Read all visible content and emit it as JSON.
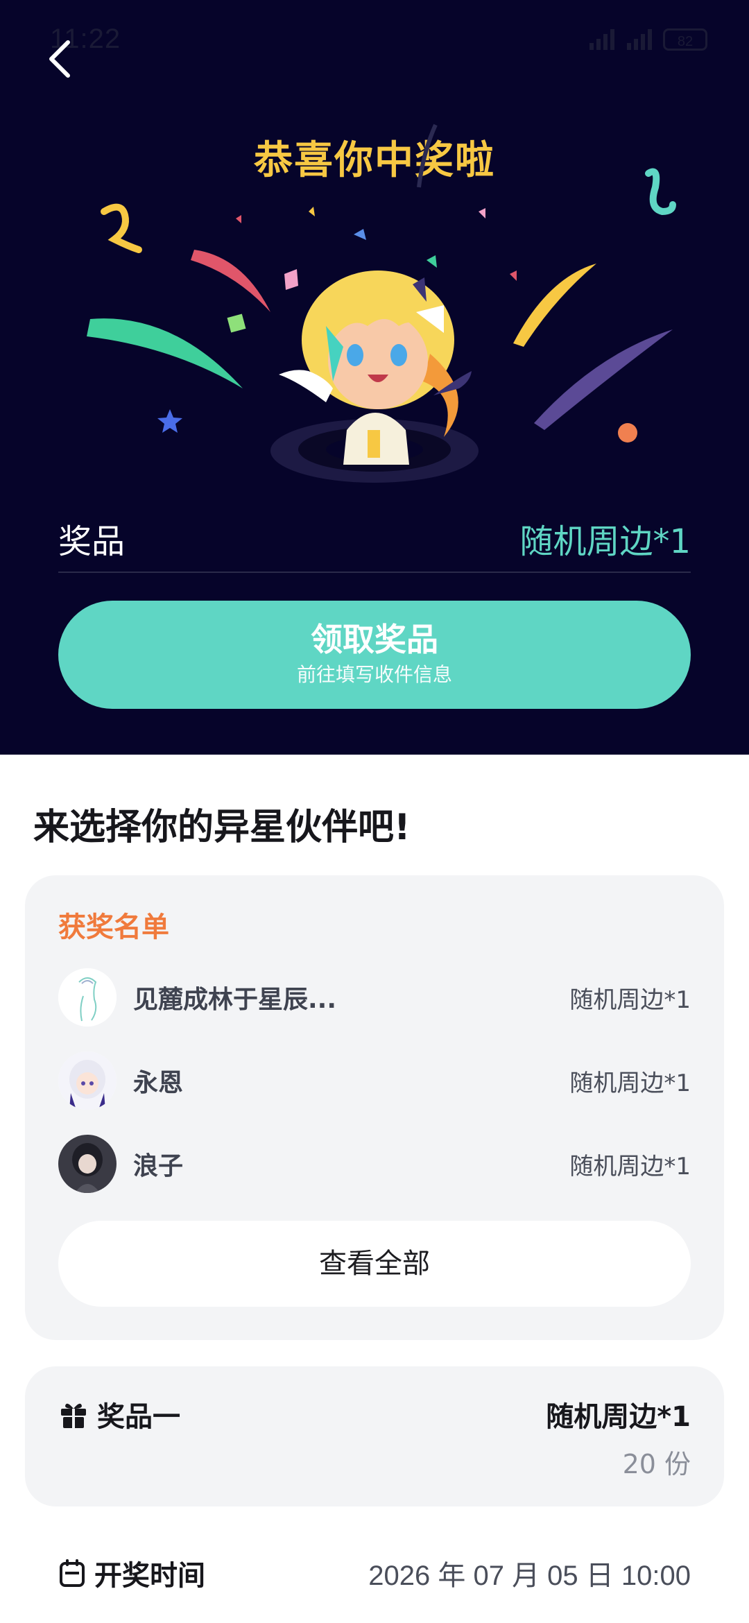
{
  "status_bar": {
    "time": "11:22",
    "battery": "82"
  },
  "hero": {
    "title": "恭喜你中奖啦",
    "prize_label": "奖品",
    "prize_value": "随机周边*1",
    "claim_button": {
      "label": "领取奖品",
      "sublabel": "前往填写收件信息"
    }
  },
  "section_title": "来选择你的异星伙伴吧!",
  "winners": {
    "title": "获奖名单",
    "items": [
      {
        "name": "见麓成林于星辰...",
        "prize": "随机周边*1"
      },
      {
        "name": "永恩",
        "prize": "随机周边*1"
      },
      {
        "name": "浪子",
        "prize": "随机周边*1"
      }
    ],
    "view_all": "查看全部"
  },
  "prize_card": {
    "label": "奖品一",
    "name": "随机周边*1",
    "count": "20 份"
  },
  "draw_time": {
    "label": "开奖时间",
    "value": "2026 年 07 月 05 日 10:00"
  },
  "colors": {
    "hero_bg": "#06042a",
    "title_gold": "#f7c843",
    "accent_teal": "#5fd6c4",
    "winner_title_orange": "#f07a3c",
    "card_bg": "#f3f4f6"
  },
  "icons": [
    "back-arrow-icon",
    "gift-icon",
    "calendar-icon"
  ]
}
